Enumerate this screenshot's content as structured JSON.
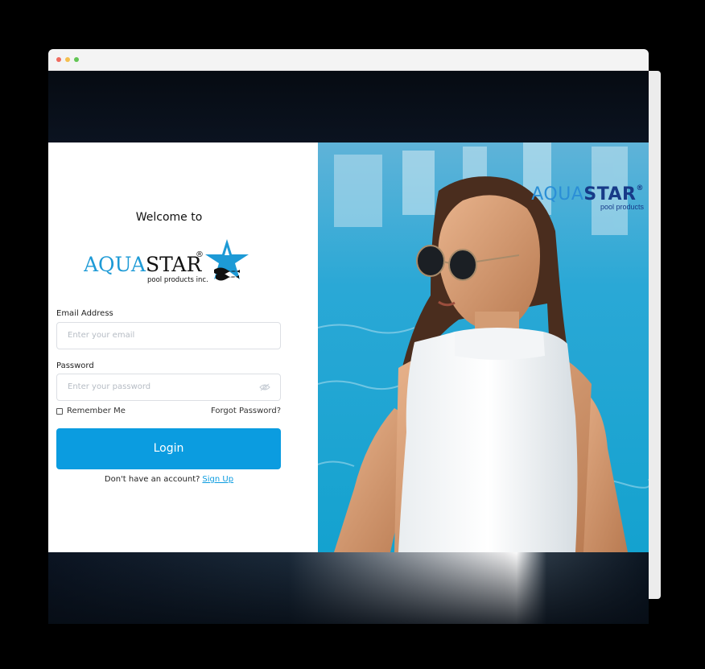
{
  "welcome_text": "Welcome to",
  "logo": {
    "brand_part1": "AQUA",
    "brand_part2": "STAR",
    "registered_mark": "®",
    "subtitle": "pool products inc."
  },
  "form": {
    "email_label": "Email Address",
    "email_placeholder": "Enter your email",
    "email_value": "",
    "password_label": "Password",
    "password_placeholder": "Enter your password",
    "password_value": "",
    "remember_label": "Remember Me",
    "remember_checked": false,
    "forgot_link": "Forgot Password?",
    "login_button": "Login",
    "signup_prompt": "Don't have an account?",
    "signup_link": "Sign Up"
  },
  "hero": {
    "brand_part1": "AQUA",
    "brand_part2": "STAR",
    "registered_mark": "®",
    "subtitle": "pool products"
  },
  "colors": {
    "accent": "#0b9ce0",
    "brand_light_blue": "#2b8fd6",
    "brand_dark_blue": "#173a88",
    "pool_water": "#18a6cc"
  },
  "icons": {
    "password_toggle": "eye-off-icon",
    "window_controls": [
      "close-dot",
      "minimize-dot",
      "maximize-dot"
    ]
  }
}
